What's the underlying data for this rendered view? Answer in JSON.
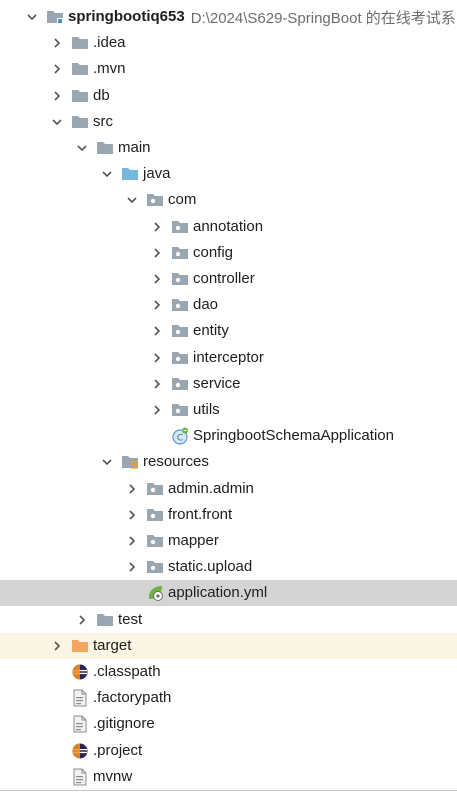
{
  "project": {
    "name": "springbootiq653",
    "path": "D:\\2024\\S629-SpringBoot 的在线考试系"
  },
  "tree": [
    {
      "label": "springbootiq653",
      "depth": 0,
      "arrow": "down",
      "icon": "module-folder-icon",
      "bold": true
    },
    {
      "label": ".idea",
      "depth": 1,
      "arrow": "right",
      "icon": "folder-icon"
    },
    {
      "label": ".mvn",
      "depth": 1,
      "arrow": "right",
      "icon": "folder-icon"
    },
    {
      "label": "db",
      "depth": 1,
      "arrow": "right",
      "icon": "folder-icon"
    },
    {
      "label": "src",
      "depth": 1,
      "arrow": "down",
      "icon": "folder-icon"
    },
    {
      "label": "main",
      "depth": 2,
      "arrow": "down",
      "icon": "folder-icon"
    },
    {
      "label": "java",
      "depth": 3,
      "arrow": "down",
      "icon": "source-root-icon"
    },
    {
      "label": "com",
      "depth": 4,
      "arrow": "down",
      "icon": "package-icon"
    },
    {
      "label": "annotation",
      "depth": 5,
      "arrow": "right",
      "icon": "package-icon"
    },
    {
      "label": "config",
      "depth": 5,
      "arrow": "right",
      "icon": "package-icon"
    },
    {
      "label": "controller",
      "depth": 5,
      "arrow": "right",
      "icon": "package-icon"
    },
    {
      "label": "dao",
      "depth": 5,
      "arrow": "right",
      "icon": "package-icon"
    },
    {
      "label": "entity",
      "depth": 5,
      "arrow": "right",
      "icon": "package-icon"
    },
    {
      "label": "interceptor",
      "depth": 5,
      "arrow": "right",
      "icon": "package-icon"
    },
    {
      "label": "service",
      "depth": 5,
      "arrow": "right",
      "icon": "package-icon"
    },
    {
      "label": "utils",
      "depth": 5,
      "arrow": "right",
      "icon": "package-icon"
    },
    {
      "label": "SpringbootSchemaApplication",
      "depth": 5,
      "arrow": "none",
      "icon": "spring-boot-class-icon"
    },
    {
      "label": "resources",
      "depth": 3,
      "arrow": "down",
      "icon": "resources-root-icon"
    },
    {
      "label": "admin.admin",
      "depth": 4,
      "arrow": "right",
      "icon": "package-icon"
    },
    {
      "label": "front.front",
      "depth": 4,
      "arrow": "right",
      "icon": "package-icon"
    },
    {
      "label": "mapper",
      "depth": 4,
      "arrow": "right",
      "icon": "package-icon"
    },
    {
      "label": "static.upload",
      "depth": 4,
      "arrow": "right",
      "icon": "package-icon"
    },
    {
      "label": "application.yml",
      "depth": 4,
      "arrow": "none",
      "icon": "spring-config-icon",
      "selected": true
    },
    {
      "label": "test",
      "depth": 2,
      "arrow": "right",
      "icon": "folder-icon"
    },
    {
      "label": "target",
      "depth": 1,
      "arrow": "right",
      "icon": "excluded-folder-icon",
      "highlight": true
    },
    {
      "label": ".classpath",
      "depth": 1,
      "arrow": "none",
      "icon": "eclipse-icon"
    },
    {
      "label": ".factorypath",
      "depth": 1,
      "arrow": "none",
      "icon": "text-file-icon"
    },
    {
      "label": ".gitignore",
      "depth": 1,
      "arrow": "none",
      "icon": "text-file-icon"
    },
    {
      "label": ".project",
      "depth": 1,
      "arrow": "none",
      "icon": "eclipse-icon"
    },
    {
      "label": "mvnw",
      "depth": 1,
      "arrow": "none",
      "icon": "text-file-icon"
    }
  ],
  "colors": {
    "folder": "#9aa7b0",
    "source_root": "#76b7e0",
    "excluded": "#f4a660",
    "selected_bg": "#d4d4d4",
    "highlight_bg": "#fbf6e3",
    "spring_green": "#6db33f"
  }
}
